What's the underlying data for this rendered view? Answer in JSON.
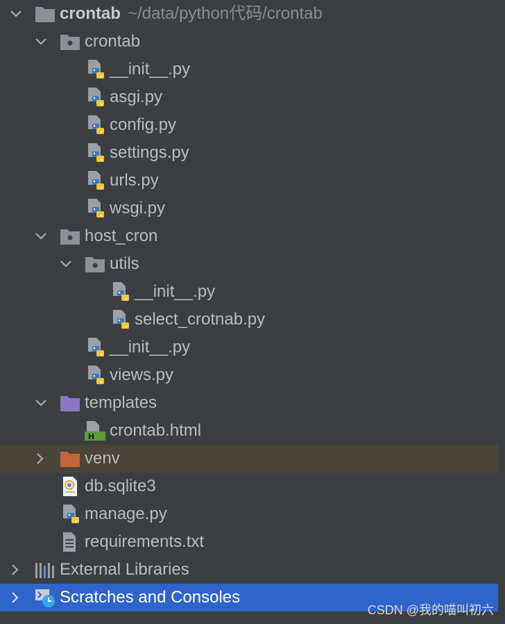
{
  "tree": {
    "root": {
      "name": "crontab",
      "path": "~/data/python代码/crontab"
    },
    "crontab_pkg": {
      "name": "crontab"
    },
    "crontab_files": [
      "__init__.py",
      "asgi.py",
      "config.py",
      "settings.py",
      "urls.py",
      "wsgi.py"
    ],
    "host_cron": {
      "name": "host_cron"
    },
    "utils": {
      "name": "utils"
    },
    "utils_files": [
      "__init__.py",
      "select_crotnab.py"
    ],
    "host_cron_files": [
      "__init__.py",
      "views.py"
    ],
    "templates": {
      "name": "templates"
    },
    "template_files": [
      "crontab.html"
    ],
    "venv": {
      "name": "venv"
    },
    "root_files": {
      "db": "db.sqlite3",
      "manage": "manage.py",
      "requirements": "requirements.txt"
    },
    "external_libraries": "External Libraries",
    "scratches": "Scratches and Consoles"
  },
  "watermark": "CSDN @我的喵叫初六",
  "colors": {
    "background": "#3c3f41",
    "selected_row": "#2f65ca",
    "venv_row": "#4a4538",
    "folder_grey": "#8c9196",
    "folder_purple": "#8b77c4",
    "folder_orange": "#c4643b",
    "python_blue": "#3f7ab8",
    "python_yellow": "#f2c53d",
    "html_green": "#5a9a3a"
  }
}
